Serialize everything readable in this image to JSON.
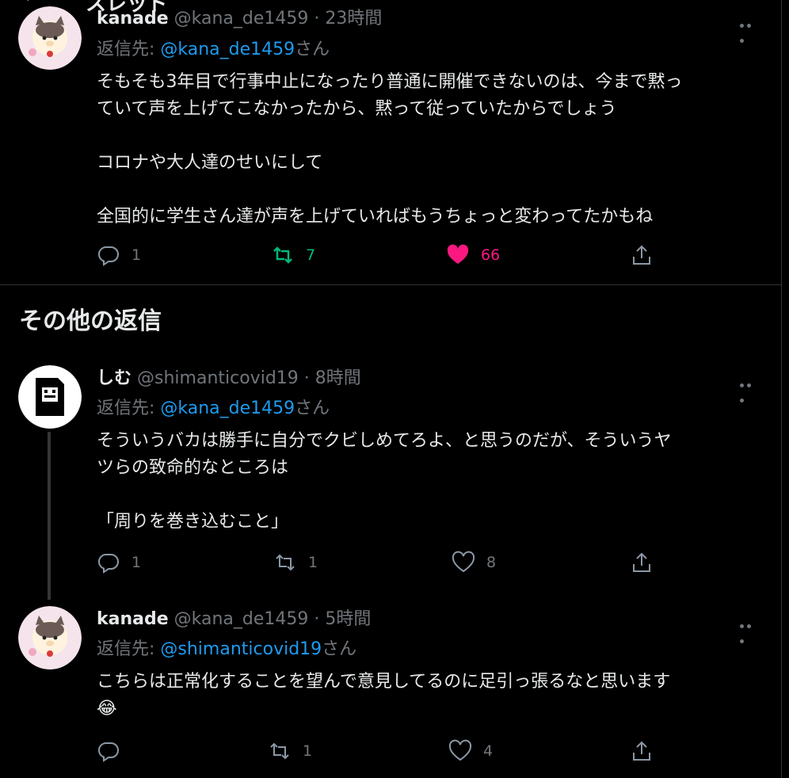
{
  "header": {
    "title": "スレッド"
  },
  "tweets": [
    {
      "name": "kanade",
      "handle": "@kana_de1459",
      "time": "· 23時間",
      "reply_prefix": "返信先: ",
      "reply_to": "@kana_de1459",
      "reply_suffix": "さん",
      "text": "そもそも3年目で行事中止になったり普通に開催できないのは、今まで黙っ\nていて声を上げてこなかったから、黙って従っていたからでしょう\n\nコロナや大人達のせいにして\n\n全国的に学生さん達が声を上げていればもうちょっと変わってたかもね",
      "replies": "1",
      "retweets": "7",
      "likes": "66",
      "liked": true,
      "retweeted": true
    },
    {
      "name": "しむ",
      "handle": "@shimanticovid19",
      "time": "· 8時間",
      "reply_prefix": "返信先: ",
      "reply_to": "@kana_de1459",
      "reply_suffix": "さん",
      "text": "そういうバカは勝手に自分でクビしめてろよ、と思うのだが、そういうヤ\nツらの致命的なところは\n\n「周りを巻き込むこと」",
      "replies": "1",
      "retweets": "1",
      "likes": "8"
    },
    {
      "name": "kanade",
      "handle": "@kana_de1459",
      "time": "· 5時間",
      "reply_prefix": "返信先: ",
      "reply_to": "@shimanticovid19",
      "reply_suffix": "さん",
      "text": "こちらは正常化することを望んで意見してるのに足引っ張るなと思います\n😂",
      "replies": "",
      "retweets": "1",
      "likes": "4"
    }
  ],
  "section": {
    "other_replies": "その他の返信"
  },
  "colors": {
    "accent": "#1d9bf0",
    "like": "#f91880",
    "retweet": "#00ba7c",
    "muted": "#71767b"
  }
}
